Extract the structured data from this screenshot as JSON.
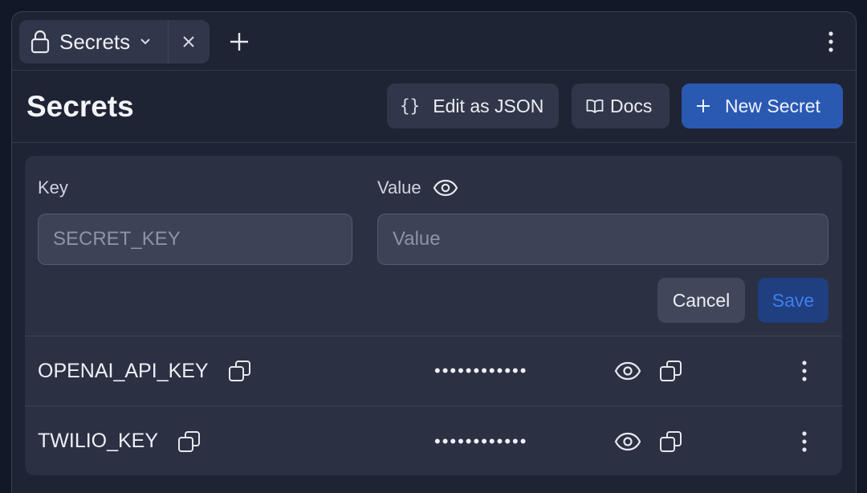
{
  "tab": {
    "label": "Secrets",
    "icon": "lock-icon"
  },
  "header": {
    "title": "Secrets",
    "edit_json_label": "Edit as JSON",
    "edit_json_glyph": "{}",
    "docs_label": "Docs",
    "new_secret_label": "New Secret"
  },
  "form": {
    "key_label": "Key",
    "value_label": "Value",
    "key_placeholder": "SECRET_KEY",
    "value_placeholder": "Value",
    "cancel_label": "Cancel",
    "save_label": "Save"
  },
  "secrets": [
    {
      "key": "OPENAI_API_KEY",
      "masked_value": "••••••••••••"
    },
    {
      "key": "TWILIO_KEY",
      "masked_value": "••••••••••••"
    }
  ],
  "colors": {
    "background": "#111827",
    "window": "#1f2434",
    "panel": "#2b3043",
    "primary": "#2a59b2",
    "save_disabled_bg": "#203f80",
    "save_disabled_text": "#3d7ff0"
  }
}
